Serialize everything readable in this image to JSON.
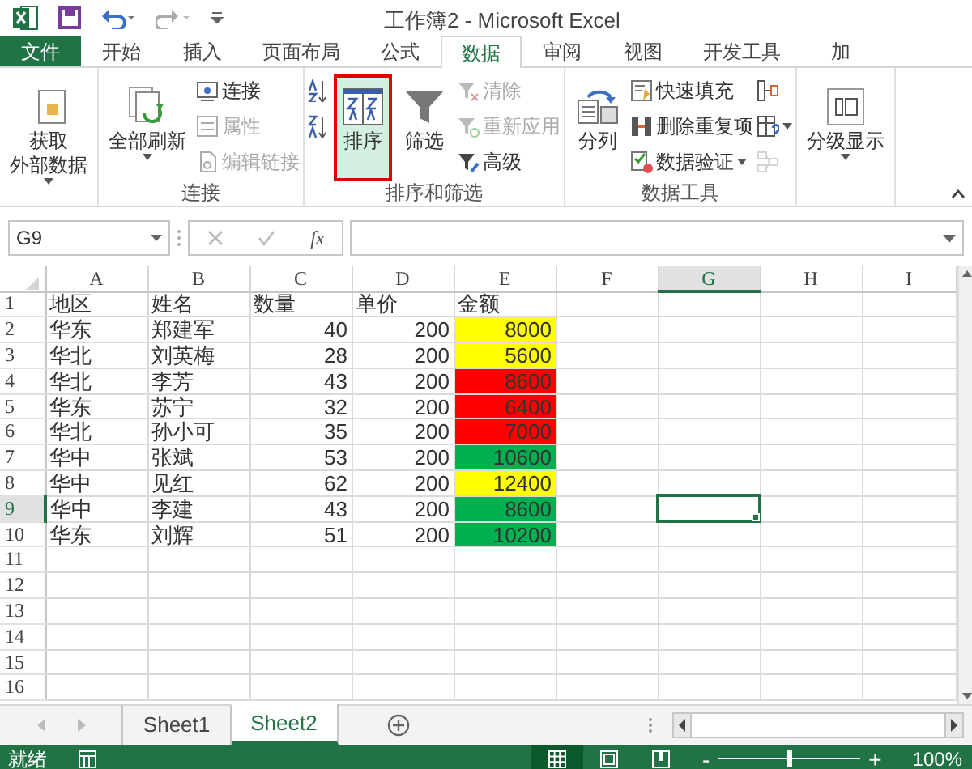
{
  "window": {
    "title": "工作簿2 - Microsoft Excel"
  },
  "tabs": [
    {
      "label": "文件",
      "kind": "file",
      "selected": false
    },
    {
      "label": "开始",
      "kind": "tab",
      "selected": false
    },
    {
      "label": "插入",
      "kind": "tab",
      "selected": false
    },
    {
      "label": "页面布局",
      "kind": "tab",
      "selected": false
    },
    {
      "label": "公式",
      "kind": "tab",
      "selected": false
    },
    {
      "label": "数据",
      "kind": "tab",
      "selected": true
    },
    {
      "label": "审阅",
      "kind": "tab",
      "selected": false
    },
    {
      "label": "视图",
      "kind": "tab",
      "selected": false
    },
    {
      "label": "开发工具",
      "kind": "tab",
      "selected": false
    },
    {
      "label": "加",
      "kind": "tab",
      "selected": false
    }
  ],
  "ribbon": {
    "groups": [
      {
        "columns": [
          [
            {
              "kind": "large",
              "lines": [
                "获取",
                "外部数据"
              ],
              "dropdown": true,
              "disabled": false,
              "selected": false
            }
          ]
        ]
      },
      {
        "label": "连接",
        "columns": [
          [
            {
              "kind": "large",
              "lines": [
                "全部刷新"
              ],
              "dropdown": true,
              "disabled": false,
              "selected": false
            }
          ],
          [
            {
              "kind": "small",
              "label": "连接",
              "disabled": false
            },
            {
              "kind": "small",
              "label": "属性",
              "disabled": true
            },
            {
              "kind": "small",
              "label": "编辑链接",
              "disabled": true
            }
          ]
        ]
      },
      {
        "label": "排序和筛选",
        "columns": [
          [
            {
              "kind": "icon",
              "disabled": false
            },
            {
              "kind": "icon",
              "disabled": false
            }
          ],
          [
            {
              "kind": "large",
              "lines": [
                "排序"
              ],
              "dropdown": false,
              "disabled": false,
              "selected": true
            }
          ],
          [
            {
              "kind": "large",
              "lines": [
                "筛选"
              ],
              "dropdown": false,
              "disabled": false,
              "selected": false
            }
          ],
          [
            {
              "kind": "small",
              "label": "清除",
              "disabled": true
            },
            {
              "kind": "small",
              "label": "重新应用",
              "disabled": true
            },
            {
              "kind": "small",
              "label": "高级",
              "disabled": false
            }
          ]
        ]
      },
      {
        "label": "数据工具",
        "columns": [
          [
            {
              "kind": "large",
              "lines": [
                "分列"
              ],
              "dropdown": false,
              "disabled": false,
              "selected": false
            }
          ],
          [
            {
              "kind": "small",
              "label": "快速填充",
              "disabled": false
            },
            {
              "kind": "small",
              "label": "删除重复项",
              "disabled": false
            },
            {
              "kind": "small",
              "label": "数据验证",
              "dropdown": true,
              "disabled": false
            }
          ],
          [
            {
              "kind": "icon",
              "disabled": false
            },
            {
              "kind": "icon",
              "dropdown": true,
              "disabled": false
            },
            {
              "kind": "icon",
              "disabled": true
            }
          ]
        ]
      },
      {
        "columns": [
          [
            {
              "kind": "large",
              "lines": [
                "分级显示"
              ],
              "dropdown": true,
              "disabled": false,
              "selected": false
            }
          ]
        ]
      }
    ]
  },
  "formula_bar": {
    "name_box": "G9",
    "function_label": "fx"
  },
  "sheet": {
    "columns": [
      {
        "label": "A",
        "selected": false
      },
      {
        "label": "B",
        "selected": false
      },
      {
        "label": "C",
        "selected": false
      },
      {
        "label": "D",
        "selected": false
      },
      {
        "label": "E",
        "selected": false
      },
      {
        "label": "F",
        "selected": false
      },
      {
        "label": "G",
        "selected": true
      },
      {
        "label": "H",
        "selected": false
      },
      {
        "label": "I",
        "selected": false
      }
    ],
    "rows": [
      {
        "number": "1",
        "kind": "header",
        "selected": false,
        "cells": [
          "地区",
          "姓名",
          "数量",
          "单价",
          "金额"
        ]
      },
      {
        "number": "2",
        "kind": "data",
        "selected": false,
        "cells": [
          "华东",
          "郑建军",
          "40",
          "200",
          "8000"
        ],
        "color": "#ffff00"
      },
      {
        "number": "3",
        "kind": "data",
        "selected": false,
        "cells": [
          "华北",
          "刘英梅",
          "28",
          "200",
          "5600"
        ],
        "color": "#ffff00"
      },
      {
        "number": "4",
        "kind": "data",
        "selected": false,
        "cells": [
          "华北",
          "李芳",
          "43",
          "200",
          "8600"
        ],
        "color": "#ff0000"
      },
      {
        "number": "5",
        "kind": "data",
        "selected": false,
        "cells": [
          "华东",
          "苏宁",
          "32",
          "200",
          "6400"
        ],
        "color": "#ff0000"
      },
      {
        "number": "6",
        "kind": "data",
        "selected": false,
        "cells": [
          "华北",
          "孙小可",
          "35",
          "200",
          "7000"
        ],
        "color": "#ff0000"
      },
      {
        "number": "7",
        "kind": "data",
        "selected": false,
        "cells": [
          "华中",
          "张斌",
          "53",
          "200",
          "10600"
        ],
        "color": "#00b050"
      },
      {
        "number": "8",
        "kind": "data",
        "selected": false,
        "cells": [
          "华中",
          "见红",
          "62",
          "200",
          "12400"
        ],
        "color": "#ffff00"
      },
      {
        "number": "9",
        "kind": "data",
        "selected": true,
        "cells": [
          "华中",
          "李建",
          "43",
          "200",
          "8600"
        ],
        "color": "#00b050"
      },
      {
        "number": "10",
        "kind": "data",
        "selected": false,
        "cells": [
          "华东",
          "刘辉",
          "51",
          "200",
          "10200"
        ],
        "color": "#00b050"
      },
      {
        "number": "11",
        "selected": false,
        "cells": []
      },
      {
        "number": "12",
        "selected": false,
        "cells": []
      },
      {
        "number": "13",
        "selected": false,
        "cells": []
      },
      {
        "number": "14",
        "selected": false,
        "cells": []
      },
      {
        "number": "15",
        "selected": false,
        "cells": []
      },
      {
        "number": "16",
        "selected": false,
        "cells": []
      }
    ]
  },
  "sheet_tabs": [
    {
      "label": "Sheet1",
      "selected": false
    },
    {
      "label": "Sheet2",
      "selected": true
    }
  ],
  "status_bar": {
    "status": "就绪",
    "views": [
      {
        "kind": "normal",
        "selected": true
      },
      {
        "kind": "page-layout",
        "selected": false
      },
      {
        "kind": "page-break",
        "selected": false
      }
    ],
    "zoom": {
      "out_label": "-",
      "in_label": "+",
      "level": 0.5,
      "reading": "100%"
    }
  }
}
